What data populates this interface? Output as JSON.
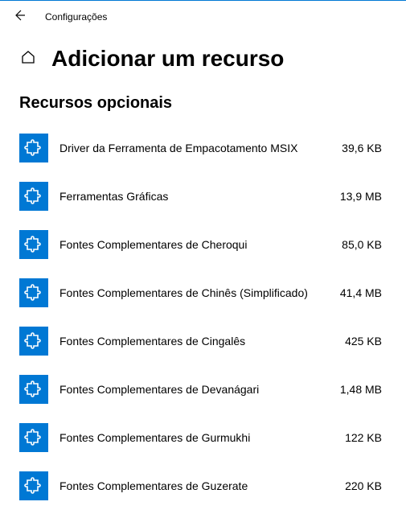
{
  "header": {
    "app_title": "Configurações"
  },
  "page": {
    "title": "Adicionar um recurso",
    "section_title": "Recursos opcionais"
  },
  "features": [
    {
      "name": "Driver da Ferramenta de Empacotamento MSIX",
      "size": "39,6 KB"
    },
    {
      "name": "Ferramentas Gráficas",
      "size": "13,9 MB"
    },
    {
      "name": "Fontes Complementares de Cheroqui",
      "size": "85,0 KB"
    },
    {
      "name": "Fontes Complementares de Chinês (Simplificado)",
      "size": "41,4 MB"
    },
    {
      "name": "Fontes Complementares de Cingalês",
      "size": "425 KB"
    },
    {
      "name": "Fontes Complementares de Devanágari",
      "size": "1,48 MB"
    },
    {
      "name": "Fontes Complementares de Gurmukhi",
      "size": "122 KB"
    },
    {
      "name": "Fontes Complementares de Guzerate",
      "size": "220 KB"
    }
  ]
}
